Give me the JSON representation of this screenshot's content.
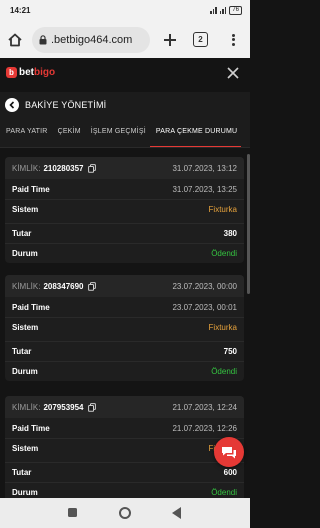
{
  "status_bar": {
    "time": "14:21",
    "battery": "76"
  },
  "browser": {
    "url": ".betbigo464.com",
    "tab_count": "2"
  },
  "brand": {
    "mark": "b",
    "name_prefix": "bet",
    "name_suffix": "bigo",
    "accent_color": "#e53935"
  },
  "panel": {
    "title": "BAKİYE YÖNETİMİ"
  },
  "tabs": [
    {
      "label": "PARA YATIR"
    },
    {
      "label": "ÇEKİM"
    },
    {
      "label": "İŞLEM GEÇMİŞİ"
    },
    {
      "label": "PARA ÇEKME DURUMU",
      "active": true
    }
  ],
  "labels": {
    "id": "KİMLİK:",
    "paid_time": "Paid Time",
    "system": "Sistem",
    "amount": "Tutar",
    "status": "Durum"
  },
  "transactions": [
    {
      "id": "210280357",
      "date": "31.07.2023, 13:12",
      "paid_time": "31.07.2023, 13:25",
      "system": "Fixturka",
      "amount": "380",
      "status": "Ödendi"
    },
    {
      "id": "208347690",
      "date": "23.07.2023, 00:00",
      "paid_time": "23.07.2023, 00:01",
      "system": "Fixturka",
      "amount": "750",
      "status": "Ödendi"
    },
    {
      "id": "207953954",
      "date": "21.07.2023, 12:24",
      "paid_time": "21.07.2023, 12:26",
      "system": "Fixturka",
      "amount": "600",
      "status": "Ödendi"
    }
  ]
}
